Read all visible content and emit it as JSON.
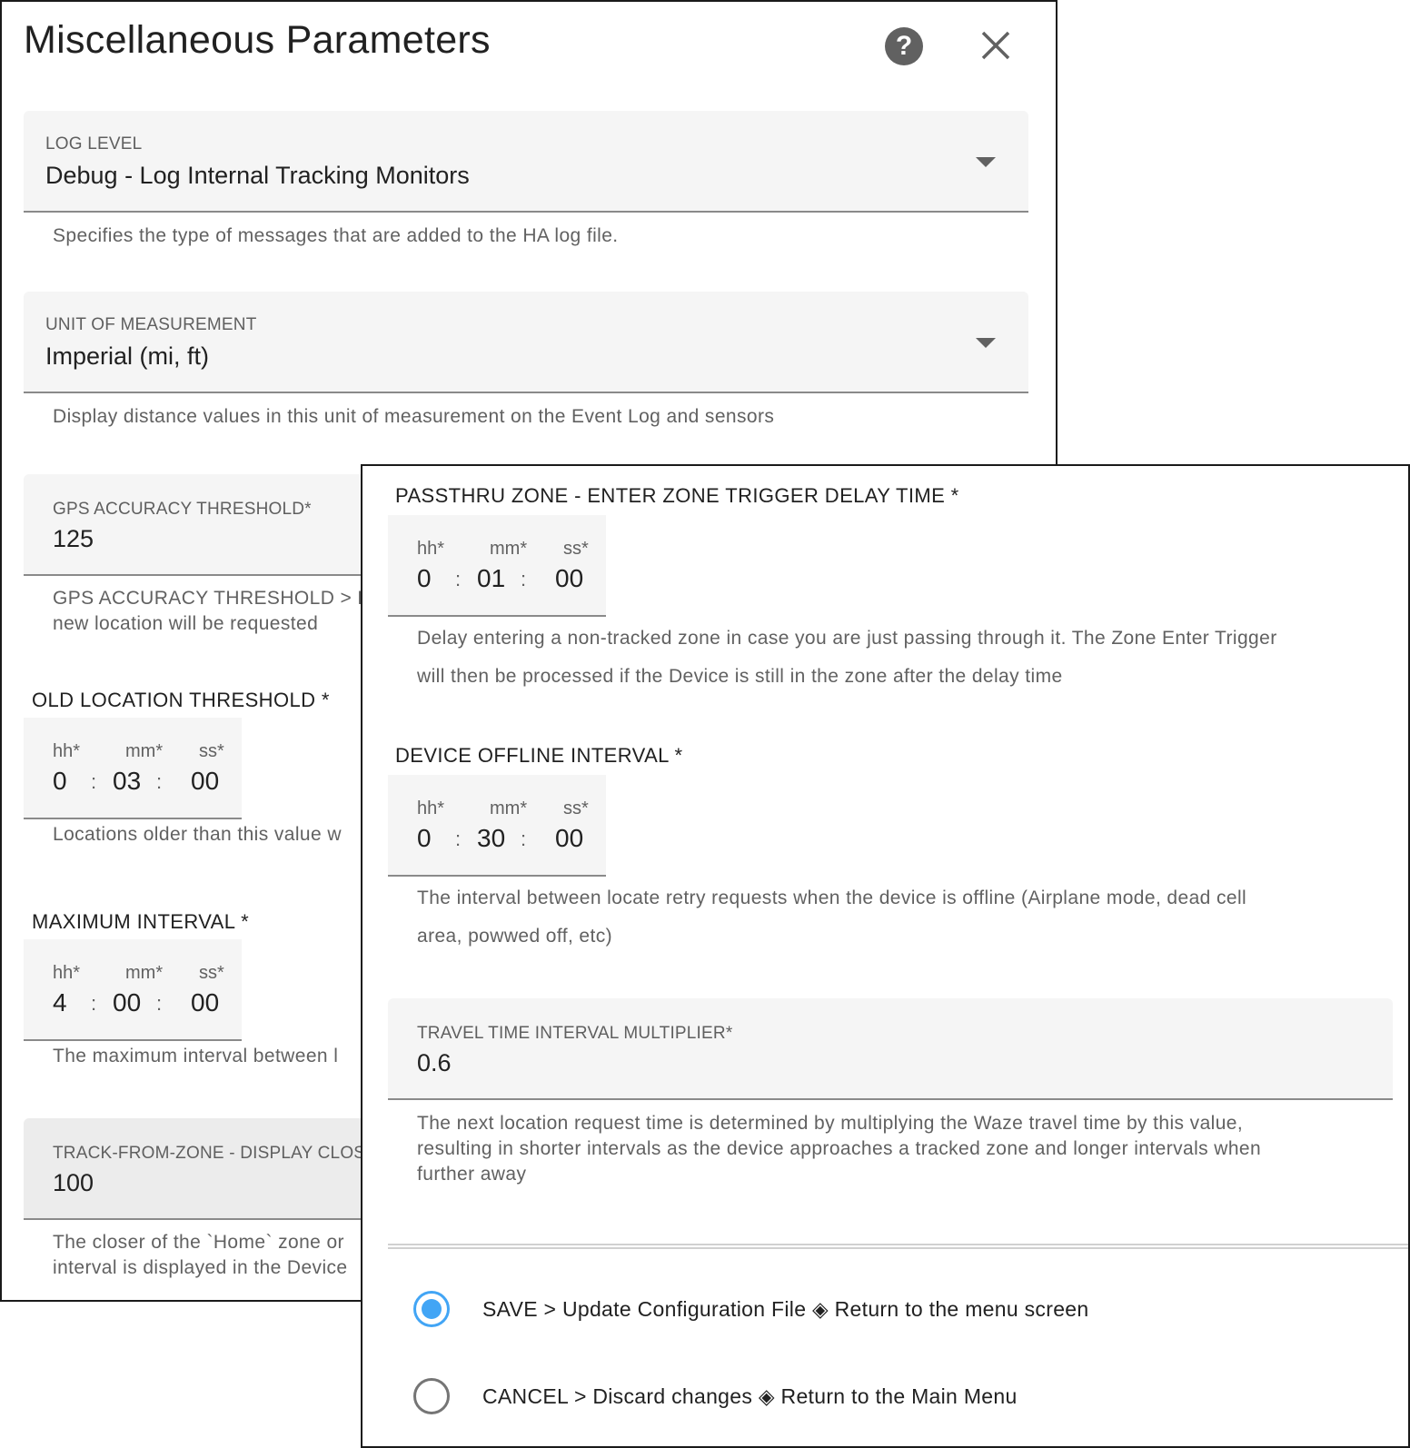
{
  "dialog": {
    "title": "Miscellaneous Parameters",
    "help_icon": "question-circle-icon",
    "close_icon": "close-icon"
  },
  "log_level": {
    "label": "LOG LEVEL",
    "value": "Debug - Log Internal Tracking Monitors",
    "helper": "Specifies the type of messages that are added to the HA log file."
  },
  "unit_of_measurement": {
    "label": "UNIT OF MEASUREMENT",
    "value": "Imperial (mi, ft)",
    "helper": "Display distance values in this unit of measurement on the Event Log and sensors"
  },
  "gps_accuracy": {
    "label": "GPS ACCURACY THRESHOLD*",
    "value": "125",
    "helper_line1": "GPS ACCURACY THRESHOLD > L",
    "helper_line2": "new location will be requested"
  },
  "old_location": {
    "label": "OLD LOCATION THRESHOLD *",
    "hh_label": "hh*",
    "mm_label": "mm*",
    "ss_label": "ss*",
    "hh": "0",
    "mm": "03",
    "ss": "00",
    "helper": "Locations older than this value w"
  },
  "max_interval": {
    "label": "MAXIMUM INTERVAL *",
    "hh_label": "hh*",
    "mm_label": "mm*",
    "ss_label": "ss*",
    "hh": "4",
    "mm": "00",
    "ss": "00",
    "helper": "The maximum interval between l"
  },
  "track_from_zone": {
    "label": "TRACK-FROM-ZONE - DISPLAY CLOS",
    "value": "100",
    "helper_line1": "The closer of the `Home` zone or",
    "helper_line2": "interval is displayed in the Device"
  },
  "passthru": {
    "label": "PASSTHRU ZONE - ENTER ZONE TRIGGER DELAY TIME *",
    "hh_label": "hh*",
    "mm_label": "mm*",
    "ss_label": "ss*",
    "hh": "0",
    "mm": "01",
    "ss": "00",
    "helper_line1": "Delay entering a non-tracked zone in case you are just passing through it. The Zone Enter Trigger",
    "helper_line2": "will then be processed if the Device is still in the zone after the delay time"
  },
  "device_offline": {
    "label": "DEVICE OFFLINE INTERVAL *",
    "hh_label": "hh*",
    "mm_label": "mm*",
    "ss_label": "ss*",
    "hh": "0",
    "mm": "30",
    "ss": "00",
    "helper_line1": "The interval between locate retry requests when the device is offline (Airplane mode, dead cell",
    "helper_line2": "area, powwed off, etc)"
  },
  "travel_time": {
    "label": "TRAVEL TIME INTERVAL MULTIPLIER*",
    "value": "0.6",
    "helper_line1": "The next location request time is determined by multiplying the Waze travel time by this value,",
    "helper_line2": "resulting in shorter intervals as the device approaches a tracked zone and longer intervals when",
    "helper_line3": "further away"
  },
  "actions": {
    "save_label": "SAVE > Update Configuration File ◈ Return to the menu screen",
    "save_checked": true,
    "cancel_label": "CANCEL > Discard changes ◈ Return to the Main Menu",
    "cancel_checked": false
  },
  "colors": {
    "accent": "#42a5f5",
    "field_bg": "#f5f5f5",
    "helper_text": "#616161"
  }
}
